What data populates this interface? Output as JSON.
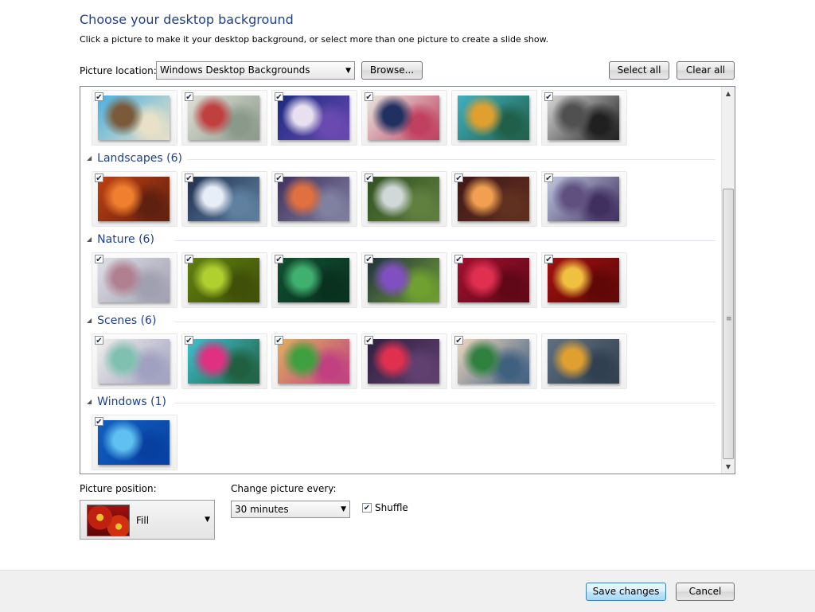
{
  "header": {
    "title": "Choose your desktop background",
    "subtitle": "Click a picture to make it your desktop background, or select more than one picture to create a slide show."
  },
  "location": {
    "label": "Picture location:",
    "value": "Windows Desktop Backgrounds",
    "browse_label": "Browse...",
    "select_all_label": "Select all",
    "clear_all_label": "Clear all"
  },
  "groups": [
    {
      "name": "top-partial",
      "header": "",
      "items": [
        {
          "checked": true,
          "colors": [
            "#4ab0e0",
            "#7a5a3a",
            "#e8e0c8"
          ]
        },
        {
          "checked": true,
          "colors": [
            "#e0e0d8",
            "#c04040",
            "#8a9a8a"
          ]
        },
        {
          "checked": true,
          "colors": [
            "#1a2a80",
            "#e8e0f0",
            "#6a4ab0"
          ]
        },
        {
          "checked": true,
          "colors": [
            "#e8e8e0",
            "#203060",
            "#c04060"
          ]
        },
        {
          "checked": false,
          "colors": [
            "#40b0c0",
            "#e0a030",
            "#20604a"
          ]
        },
        {
          "checked": true,
          "colors": [
            "#d8d8d8",
            "#505050",
            "#202020"
          ]
        }
      ]
    },
    {
      "name": "landscapes",
      "header": "Landscapes (6)",
      "items": [
        {
          "checked": true,
          "colors": [
            "#c04010",
            "#f08030",
            "#602010"
          ]
        },
        {
          "checked": true,
          "colors": [
            "#203050",
            "#e8eef8",
            "#6080a0"
          ]
        },
        {
          "checked": true,
          "colors": [
            "#403060",
            "#e07040",
            "#8080a0"
          ]
        },
        {
          "checked": true,
          "colors": [
            "#305020",
            "#d0d8d8",
            "#608040"
          ]
        },
        {
          "checked": true,
          "colors": [
            "#401818",
            "#f0a050",
            "#603020"
          ]
        },
        {
          "checked": true,
          "colors": [
            "#c0c8e0",
            "#605080",
            "#403060"
          ]
        }
      ]
    },
    {
      "name": "nature",
      "header": "Nature (6)",
      "items": [
        {
          "checked": true,
          "colors": [
            "#e0e0e8",
            "#b08090",
            "#a0a0b0"
          ]
        },
        {
          "checked": true,
          "colors": [
            "#608010",
            "#b0d030",
            "#405008"
          ]
        },
        {
          "checked": true,
          "colors": [
            "#105030",
            "#40b070",
            "#0a3020"
          ]
        },
        {
          "checked": true,
          "colors": [
            "#203040",
            "#8050c0",
            "#70a030"
          ]
        },
        {
          "checked": true,
          "colors": [
            "#a01030",
            "#e03050",
            "#600818"
          ]
        },
        {
          "checked": true,
          "colors": [
            "#a01010",
            "#f0c040",
            "#600808"
          ]
        }
      ]
    },
    {
      "name": "scenes",
      "header": "Scenes (6)",
      "items": [
        {
          "checked": true,
          "colors": [
            "#f0f0ec",
            "#80c0b0",
            "#a0a0c0"
          ]
        },
        {
          "checked": true,
          "colors": [
            "#40c0d0",
            "#e03080",
            "#206040"
          ]
        },
        {
          "checked": true,
          "colors": [
            "#e0b060",
            "#40a040",
            "#c04080"
          ]
        },
        {
          "checked": true,
          "colors": [
            "#302040",
            "#e03050",
            "#604070"
          ]
        },
        {
          "checked": true,
          "colors": [
            "#f0d8c0",
            "#308040",
            "#406080"
          ]
        },
        {
          "checked": false,
          "colors": [
            "#607080",
            "#e0a030",
            "#304050"
          ]
        }
      ]
    },
    {
      "name": "windows",
      "header": "Windows (1)",
      "items": [
        {
          "checked": true,
          "colors": [
            "#1060c0",
            "#60c0f0",
            "#0840a0"
          ]
        }
      ]
    }
  ],
  "picture_position": {
    "label": "Picture position:",
    "value": "Fill"
  },
  "change_picture": {
    "label": "Change picture every:",
    "value": "30 minutes"
  },
  "shuffle": {
    "label": "Shuffle",
    "checked": true
  },
  "footer": {
    "save_label": "Save changes",
    "cancel_label": "Cancel"
  }
}
